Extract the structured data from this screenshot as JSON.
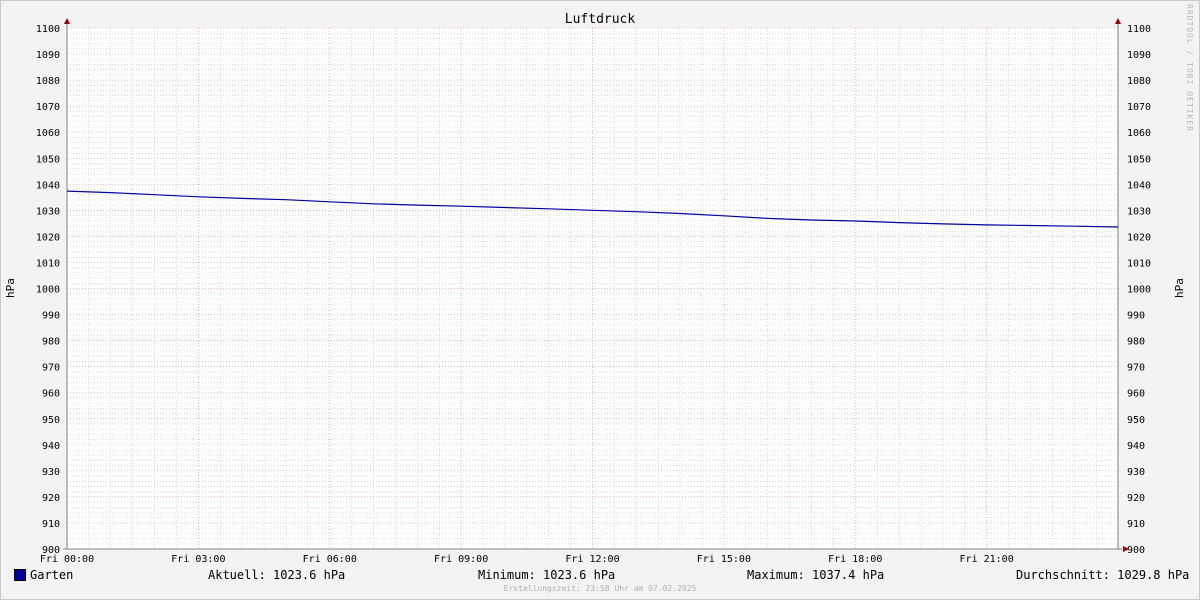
{
  "watermark": "RRDTOOL / TOBI OETIKER",
  "footer": "Erstellungszeit: 23:58 Uhr am 07.02.2025",
  "legend": {
    "series_name": "Garten",
    "current": "Aktuell: 1023.6 hPa",
    "minimum": "Minimum: 1023.6 hPa",
    "maximum": "Maximum: 1037.4 hPa",
    "average": "Durchschnitt: 1029.8 hPa"
  },
  "colors": {
    "series": "#0000a0",
    "major_grid": "#e6a0a0",
    "minor_grid": "#c8c8c8",
    "axis": "#808080",
    "arrow": "#a00000"
  },
  "chart_data": {
    "type": "line",
    "title": "Luftdruck",
    "ylabel": "hPa",
    "ylabel_right": "hPa",
    "ylim": [
      900,
      1100
    ],
    "yticks": [
      900,
      910,
      920,
      930,
      940,
      950,
      960,
      970,
      980,
      990,
      1000,
      1010,
      1020,
      1030,
      1040,
      1050,
      1060,
      1070,
      1080,
      1090,
      1100
    ],
    "xlim_hours": [
      0,
      24
    ],
    "xticks": [
      {
        "hour": 0,
        "label": "Fri 00:00"
      },
      {
        "hour": 3,
        "label": "Fri 03:00"
      },
      {
        "hour": 6,
        "label": "Fri 06:00"
      },
      {
        "hour": 9,
        "label": "Fri 09:00"
      },
      {
        "hour": 12,
        "label": "Fri 12:00"
      },
      {
        "hour": 15,
        "label": "Fri 15:00"
      },
      {
        "hour": 18,
        "label": "Fri 18:00"
      },
      {
        "hour": 21,
        "label": "Fri 21:00"
      }
    ],
    "grid": true,
    "series": [
      {
        "name": "Garten",
        "x": [
          0,
          1,
          2,
          3,
          4,
          5,
          6,
          7,
          8,
          9,
          10,
          11,
          12,
          13,
          14,
          15,
          16,
          17,
          18,
          19,
          20,
          21,
          22,
          23,
          24
        ],
        "values": [
          1037.4,
          1036.8,
          1036.0,
          1035.2,
          1034.6,
          1034.1,
          1033.3,
          1032.5,
          1032.0,
          1031.6,
          1031.1,
          1030.6,
          1030.0,
          1029.5,
          1028.8,
          1027.9,
          1026.9,
          1026.3,
          1025.9,
          1025.3,
          1024.8,
          1024.4,
          1024.2,
          1023.9,
          1023.6
        ]
      }
    ]
  }
}
